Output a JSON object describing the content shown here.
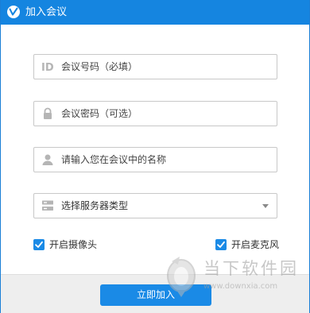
{
  "window": {
    "title": "加入会议",
    "logo_icon": "app-logo-icon"
  },
  "form": {
    "meeting_id": {
      "icon": "id-icon",
      "value": "",
      "placeholder": "会议号码（必填）"
    },
    "password": {
      "icon": "lock-icon",
      "value": "",
      "placeholder": "会议密码（可选）"
    },
    "name": {
      "icon": "user-icon",
      "value": "",
      "placeholder": "请输入您在会议中的名称"
    },
    "server_type": {
      "icon": "server-icon",
      "selected": "选择服务器类型"
    }
  },
  "options": {
    "camera": {
      "label": "开启摄像头",
      "checked": true
    },
    "microphone": {
      "label": "开启麦克风",
      "checked": true
    }
  },
  "footer": {
    "join_label": "立即加入"
  },
  "watermark": {
    "title": "当下软件园",
    "url": "www.downxia.com"
  },
  "colors": {
    "accent": "#1a8ae6",
    "titlebar": "#1585e0",
    "border": "#c8c8c8",
    "footer_bg": "#eeeeee"
  }
}
